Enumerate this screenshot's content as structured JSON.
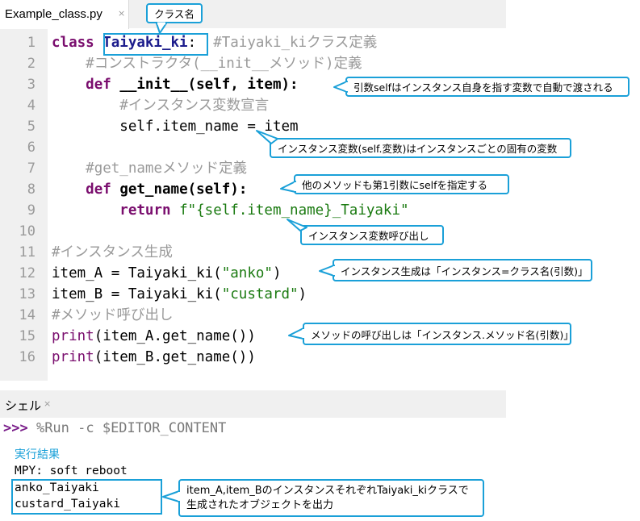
{
  "editor": {
    "tab_label": "Example_class.py",
    "tab_close": "×",
    "line_numbers": [
      "1",
      "2",
      "3",
      "4",
      "5",
      "6",
      "7",
      "8",
      "9",
      "10",
      "11",
      "12",
      "13",
      "14",
      "15",
      "16"
    ],
    "lines": {
      "l1": {
        "kw": "class ",
        "name": "Taiyaki_ki",
        "colon": ":",
        "comment": "  #Taiyaki_kiクラス定義"
      },
      "l2": {
        "indent": "    ",
        "comment": "#コンストラクタ(__init__メソッド)定義"
      },
      "l3": {
        "indent": "    ",
        "kw": "def ",
        "rest": "__init__(self, item):"
      },
      "l4": {
        "indent": "        ",
        "comment": "#インスタンス変数宣言"
      },
      "l5": {
        "indent": "        ",
        "text": "self.item_name = item"
      },
      "l7": {
        "indent": "    ",
        "comment": "#get_nameメソッド定義"
      },
      "l8": {
        "indent": "    ",
        "kw": "def ",
        "rest": "get_name(self):"
      },
      "l9": {
        "indent": "        ",
        "kw": "return ",
        "str": "f\"{self.item_name}_Taiyaki\""
      },
      "l11": {
        "comment": "#インスタンス生成"
      },
      "l12": {
        "pre": "item_A = Taiyaki_ki(",
        "str": "\"anko\"",
        "post": ")"
      },
      "l13": {
        "pre": "item_B = Taiyaki_ki(",
        "str": "\"custard\"",
        "post": ")"
      },
      "l14": {
        "comment": "#メソッド呼び出し"
      },
      "l15": {
        "kw": "print",
        "rest": "(item_A.get_name())"
      },
      "l16": {
        "kw": "print",
        "rest": "(item_B.get_name())"
      }
    }
  },
  "shell": {
    "tab_label": "シェル",
    "tab_close": "×",
    "prompt": ">>>",
    "command": " %Run -c $EDITOR_CONTENT",
    "result_label": "実行結果",
    "output": [
      "MPY: soft reboot",
      "anko_Taiyaki",
      "custard_Taiyaki"
    ]
  },
  "annotations": {
    "class_name": "クラス名",
    "self_note": "引数selfはインスタンス自身を指す変数で自動で渡される",
    "instance_var_note": "インスタンス変数(self.変数)はインスタンスごとの固有の変数",
    "method_self_note": "他のメソッドも第1引数にselfを指定する",
    "call_note": "インスタンス変数呼び出し",
    "create_note": "インスタンス生成は「インスタンス=クラス名(引数)」",
    "method_call_note": "メソッドの呼び出しは「インスタンス.メソッド名(引数)」",
    "output_note_line1": "item_A,item_BのインスタンスそれぞれTaiyaki_kiクラスで",
    "output_note_line2": "生成されたオブジェクトを出力"
  },
  "colors": {
    "keyword": "#7a0e6e",
    "comment": "#9a9a9a",
    "string": "#1a7a10",
    "callout_border": "#1aa0d8",
    "result_label": "#1aa0d8"
  }
}
